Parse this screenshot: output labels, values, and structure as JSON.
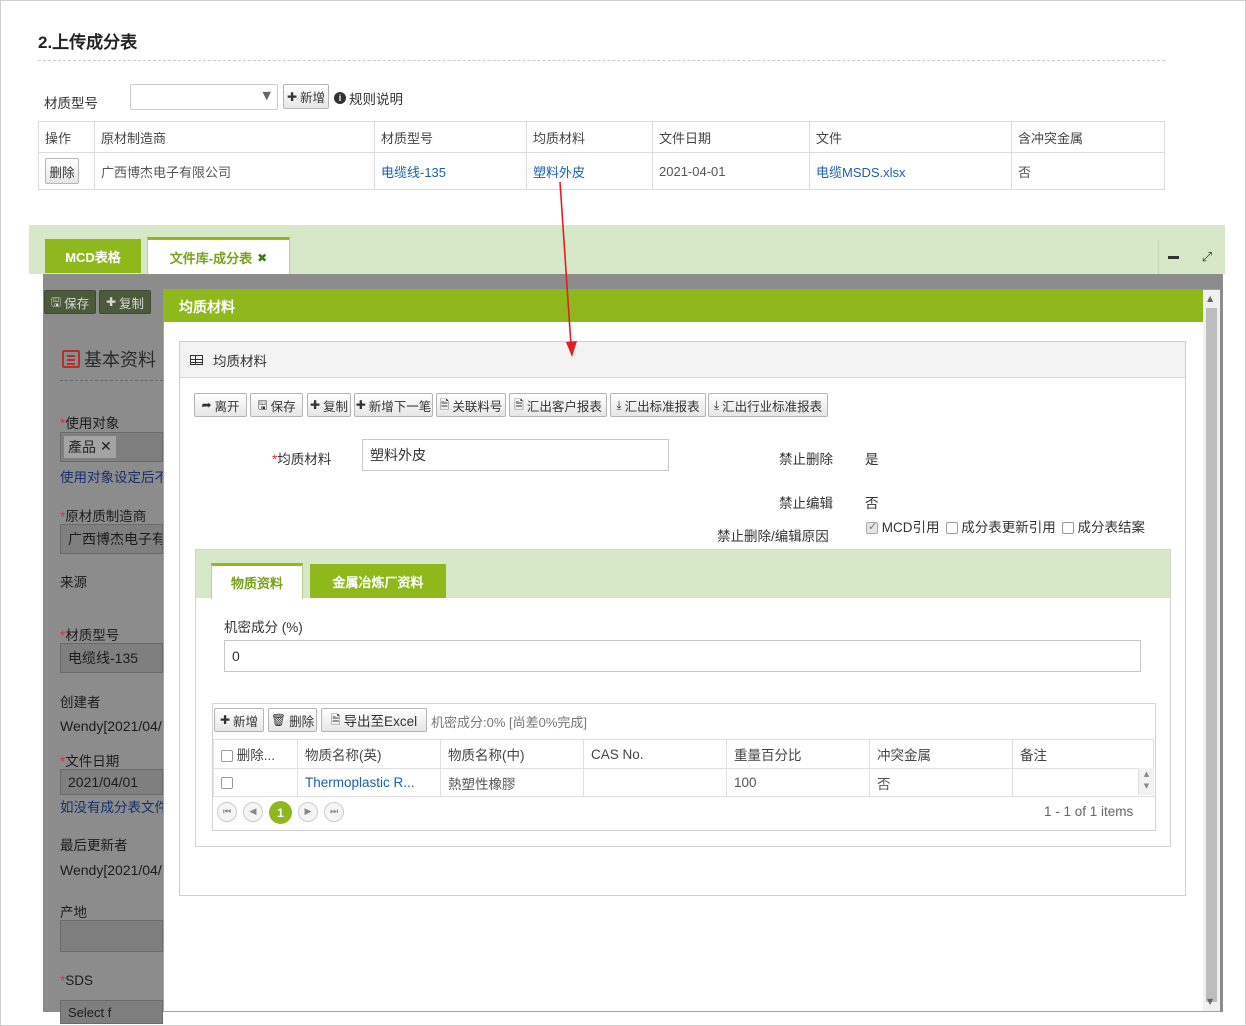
{
  "section": {
    "title": "2.上传成分表",
    "material_label": "材质型号",
    "add_label": "新增",
    "rules_label": "规则说明"
  },
  "top_table": {
    "headers": [
      "操作",
      "原材制造商",
      "材质型号",
      "均质材料",
      "文件日期",
      "文件",
      "含冲突金属"
    ],
    "row": {
      "action": "删除",
      "manufacturer": "广西博杰电子有限公司",
      "model": "电缆线-135",
      "material": "塑料外皮",
      "date": "2021-04-01",
      "file": "电缆MSDS.xlsx",
      "conflict": "否"
    }
  },
  "tabs": {
    "mcd": "MCD表格",
    "library": "文件库-成分表"
  },
  "bg_form": {
    "save": "保存",
    "copy": "复制",
    "basic": "基本资料",
    "use_target": "使用对象",
    "product": "產品",
    "use_note": "使用对象设定后不",
    "manufacturer_label": "原材质制造商",
    "manufacturer_value": "广西博杰电子有",
    "source": "来源",
    "model_label": "材质型号",
    "model_value": "电缆线-135",
    "creator_label": "创建者",
    "creator_value": "Wendy[2021/04/",
    "date_label": "文件日期",
    "date_value": "2021/04/01",
    "date_note": "如没有成分表文件",
    "updater_label": "最后更新者",
    "updater_value": "Wendy[2021/04/",
    "origin_label": "产地",
    "sds_label": "SDS",
    "sds_value": "Select f"
  },
  "modal": {
    "title": "均质材料",
    "panel_title": "均质材料",
    "toolbar": [
      "离开",
      "保存",
      "复制",
      "新增下一笔",
      "关联料号",
      "汇出客户报表",
      "汇出标准报表",
      "汇出行业标准报表"
    ],
    "material_label": "均质材料",
    "material_value": "塑料外皮",
    "no_delete_label": "禁止删除",
    "no_delete_value": "是",
    "no_edit_label": "禁止编辑",
    "no_edit_value": "否",
    "reason_label": "禁止删除/编辑原因",
    "reasons": [
      "MCD引用",
      "成分表更新引用",
      "成分表结案"
    ],
    "inner_tabs": [
      "物质资料",
      "金属冶炼厂资料"
    ],
    "secret_label": "机密成分 (%)",
    "secret_value": "0",
    "grid_toolbar": {
      "add": "新增",
      "delete": "删除",
      "export": "导出至Excel",
      "status": "机密成分:0% [尚差0%完成]"
    },
    "grid_headers": [
      "删除...",
      "物质名称(英)",
      "物质名称(中)",
      "CAS No.",
      "重量百分比",
      "冲突金属",
      "备注"
    ],
    "grid_row": {
      "name_en": "Thermoplastic R...",
      "name_cn": "熱塑性橡膠",
      "cas": "",
      "weight": "100",
      "conflict": "否",
      "remark": ""
    },
    "pager": {
      "page": "1",
      "summary": "1 - 1 of 1 items"
    }
  },
  "colors": {
    "accent": "#8fb81c",
    "tab_bg": "#d7e8c8",
    "link": "#1e5fa8",
    "arrow": "#e02020"
  }
}
